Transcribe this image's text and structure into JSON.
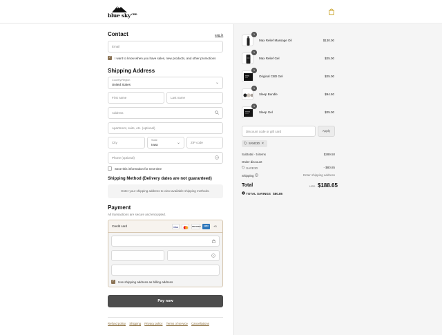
{
  "brand": {
    "name": "blue sky",
    "sub": "CBD"
  },
  "contact": {
    "title": "Contact",
    "login_link": "Log in",
    "email_placeholder": "Email",
    "marketing_label": "I want to know when you have sales, new products, and other promotions"
  },
  "shipping": {
    "title": "Shipping Address",
    "country_label": "Country/Region",
    "country_value": "United States",
    "first_name": "First name",
    "last_name": "Last name",
    "address": "Address",
    "apartment": "Apartment, suite, etc. (optional)",
    "city": "City",
    "state_label": "State",
    "state_value": "Iowa",
    "zip": "ZIP code",
    "phone": "Phone (optional)",
    "save_label": "Save this information for next time"
  },
  "method": {
    "title": "Shipping Method (Delivery dates are not guaranteed)",
    "info": "Enter your shipping address to view available shipping methods."
  },
  "payment": {
    "title": "Payment",
    "subtitle": "All transactions are secure and encrypted.",
    "credit_label": "Credit card",
    "more_cards": "+3",
    "cards": [
      "VISA",
      "mastercard",
      "DISCOVER",
      "AMEX"
    ],
    "billing_label": "Use shipping address as billing address",
    "pay_button": "Pay now"
  },
  "footer": {
    "links": [
      "Refund policy",
      "Shipping",
      "Privacy policy",
      "Terms of service",
      "Cancellations"
    ]
  },
  "cart": {
    "items": [
      {
        "name": "Max Relief Massage Oil",
        "price": "$130.00",
        "qty": "1"
      },
      {
        "name": "Max Relief Gel",
        "price": "$25.00",
        "qty": "1"
      },
      {
        "name": "Original CBD Gel",
        "price": "$25.00",
        "qty": "1"
      },
      {
        "name": "Sleep Bundle",
        "price": "$94.50",
        "qty": "1"
      },
      {
        "name": "Sleep Gel",
        "price": "$25.00",
        "qty": "1"
      }
    ],
    "discount_placeholder": "Discount code or gift card",
    "apply_label": "Apply",
    "applied_code": "SAVE30",
    "subtotal_label": "Subtotal · 5 items",
    "subtotal_value": "$289.50",
    "order_discount_label": "Order discount",
    "discount_code": "SAVE30",
    "discount_value": "- $80.85",
    "shipping_label": "Shipping",
    "shipping_value": "Enter shipping address",
    "total_label": "Total",
    "currency": "USD",
    "total_value": "$188.65",
    "savings_label": "TOTAL SAVINGS",
    "savings_value": "$80.85"
  }
}
